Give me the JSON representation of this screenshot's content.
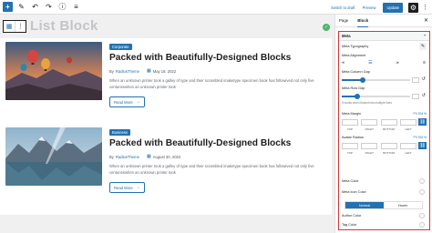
{
  "toolbar": {
    "icons": [
      "add-icon",
      "pen-icon",
      "undo-icon",
      "redo-icon",
      "info-icon",
      "list-view-icon"
    ],
    "switch_draft": "Switch to draft",
    "preview": "Preview",
    "update": "Update"
  },
  "editor": {
    "block_title": "List Block"
  },
  "posts": [
    {
      "category": "Corporate",
      "title": "Packed with Beautifully-Designed Blocks",
      "by": "By",
      "author": "RadiusTheme",
      "date": "May 18, 2022",
      "excerpt": "When an unknown printer took a galley of type and their scrambled imaketype specimen book has followived not only five centurieswhen an unknown printer took",
      "read_more": "Read More"
    },
    {
      "category": "Business",
      "title": "Packed with Beautifully-Designed Blocks",
      "by": "By",
      "author": "RadiusTheme",
      "date": "August 30, 2022",
      "excerpt": "When an unknown printer took a galley of type and their scrambled imaketype specimen book has followived not only five centurieswhen an unknown printer took",
      "read_more": "Read More"
    }
  ],
  "sidebar": {
    "tabs": [
      "Page",
      "Block"
    ],
    "active_tab": "Block",
    "panel_title": "Meta",
    "typography": "Meta Typography",
    "alignment": "Meta Alignment",
    "column_gap": "Meta Column Gap",
    "column_gap_value": "",
    "row_gap": "Meta Row Gap",
    "row_gap_value": "",
    "row_gap_help": "It works when flowed into multiple lines",
    "margin": "Meta Margin",
    "margin_unit": "PX EM %",
    "dims": [
      "TOP",
      "RIGHT",
      "BOTTOM",
      "LEFT"
    ],
    "avatar_radius": "Avatar Radius",
    "avatar_unit": "PX EM %",
    "meta_color": "Meta Color",
    "meta_icon_color": "Meta Icon Color",
    "normal": "Normal",
    "hover": "Hover",
    "author_color": "Author Color",
    "tag_color": "Tag Color"
  },
  "colors": {
    "accent": "#2271b1",
    "highlight_border": "#d63638"
  }
}
